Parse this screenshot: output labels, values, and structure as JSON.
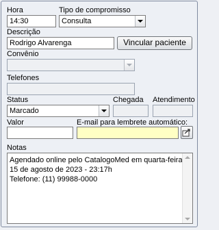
{
  "form": {
    "hora_label": "Hora",
    "hora_value": "14:30",
    "tipo_label": "Tipo de compromisso",
    "tipo_value": "Consulta",
    "descricao_label": "Descrição",
    "descricao_value": "Rodrigo Alvarenga",
    "vincular_button": "Vincular paciente",
    "convenio_label": "Convênio",
    "convenio_value": "",
    "telefones_label": "Telefones",
    "telefones_value": "",
    "status_label": "Status",
    "status_value": "Marcado",
    "chegada_label": "Chegada",
    "chegada_value": "",
    "atendimento_label": "Atendimento",
    "atendimento_value": "",
    "valor_label": "Valor",
    "valor_value": "",
    "email_label": "E-mail para lembrete automático:",
    "email_value": "",
    "notas_label": "Notas",
    "notas_lines": [
      "Agendado online pelo CatalogoMed em quarta-feira,",
      "15 de agosto de 2023 - 23:17h",
      "Telefone: (11) 99988-0000"
    ]
  },
  "icons": {
    "dropdown": "chevron-down-icon",
    "email_send": "send-email-icon",
    "scroll_up": "scroll-up-icon",
    "scroll_down": "scroll-down-icon"
  },
  "colors": {
    "background": "#edf0f5",
    "email_field": "#ffffc4",
    "disabled_field": "#eef0f3"
  }
}
